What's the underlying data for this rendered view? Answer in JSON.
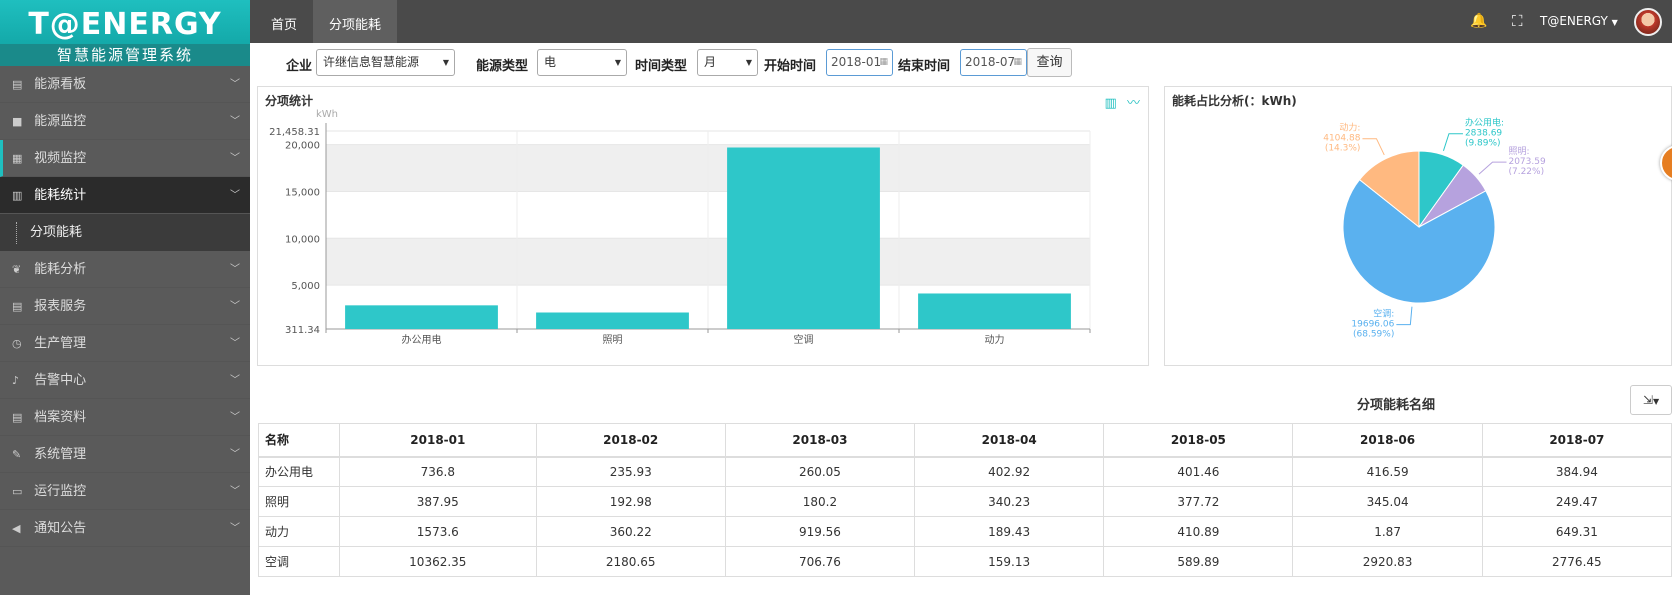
{
  "logo": {
    "brand": "T@ENERGY",
    "subtitle": "智慧能源管理系统"
  },
  "sidebar": {
    "items": [
      {
        "label": "能源看板",
        "icon": "dashboard-icon"
      },
      {
        "label": "能源监控",
        "icon": "video-camera-icon"
      },
      {
        "label": "视频监控",
        "icon": "film-icon"
      },
      {
        "label": "能耗统计",
        "icon": "bar-chart-icon"
      },
      {
        "label": "能耗分析",
        "icon": "leaf-icon"
      },
      {
        "label": "报表服务",
        "icon": "list-icon"
      },
      {
        "label": "生产管理",
        "icon": "clock-icon"
      },
      {
        "label": "告警中心",
        "icon": "bell-icon"
      },
      {
        "label": "档案资料",
        "icon": "list-icon"
      },
      {
        "label": "系统管理",
        "icon": "wrench-icon"
      },
      {
        "label": "运行监控",
        "icon": "monitor-icon"
      },
      {
        "label": "通知公告",
        "icon": "bullhorn-icon"
      }
    ],
    "submenu_label": "分项能耗"
  },
  "topbar": {
    "tabs": [
      "首页",
      "分项能耗"
    ],
    "user": "T@ENERGY"
  },
  "filters": {
    "company_label": "企业",
    "company_value": "许继信息智慧能源",
    "energy_type_label": "能源类型",
    "energy_type_value": "电",
    "time_type_label": "时间类型",
    "time_type_value": "月",
    "start_label": "开始时间",
    "start_value": "2018-01",
    "end_label": "结束时间",
    "end_value": "2018-07",
    "query_label": "查询"
  },
  "bar_panel": {
    "title": "分项统计"
  },
  "pie_panel": {
    "title": "能耗占比分析(：kWh)"
  },
  "chart_data": [
    {
      "type": "bar",
      "title": "分项统计",
      "ylabel": "kWh",
      "categories": [
        "办公用电",
        "照明",
        "空调",
        "动力"
      ],
      "values": [
        2838.69,
        2073.59,
        19696.06,
        4104.88
      ],
      "ylim": [
        311.34,
        21458.31
      ],
      "yticks": [
        "21,458.31",
        "20,000",
        "15,000",
        "10,000",
        "5,000",
        "311.34"
      ],
      "ytick_values": [
        21458.31,
        20000,
        15000,
        10000,
        5000,
        311.34
      ],
      "grid": true,
      "color": "#2ec7c9"
    },
    {
      "type": "pie",
      "title": "能耗占比分析(：kWh)",
      "slices": [
        {
          "name": "办公用电",
          "value": 2838.69,
          "percent": "9.89%",
          "color": "#2ec7c9"
        },
        {
          "name": "照明",
          "value": 2073.59,
          "percent": "7.22%",
          "color": "#b6a2de"
        },
        {
          "name": "空调",
          "value": 19696.06,
          "percent": "68.59%",
          "color": "#5ab1ef"
        },
        {
          "name": "动力",
          "value": 4104.88,
          "percent": "14.3%",
          "color": "#ffb980"
        }
      ]
    }
  ],
  "detail": {
    "title": "分项能耗名细",
    "columns": [
      "名称",
      "2018-01",
      "2018-02",
      "2018-03",
      "2018-04",
      "2018-05",
      "2018-06",
      "2018-07"
    ],
    "rows": [
      [
        "办公用电",
        "736.8",
        "235.93",
        "260.05",
        "402.92",
        "401.46",
        "416.59",
        "384.94"
      ],
      [
        "照明",
        "387.95",
        "192.98",
        "180.2",
        "340.23",
        "377.72",
        "345.04",
        "249.47"
      ],
      [
        "动力",
        "1573.6",
        "360.22",
        "919.56",
        "189.43",
        "410.89",
        "1.87",
        "649.31"
      ],
      [
        "空调",
        "10362.35",
        "2180.65",
        "706.76",
        "159.13",
        "589.89",
        "2920.83",
        "2776.45"
      ]
    ]
  }
}
